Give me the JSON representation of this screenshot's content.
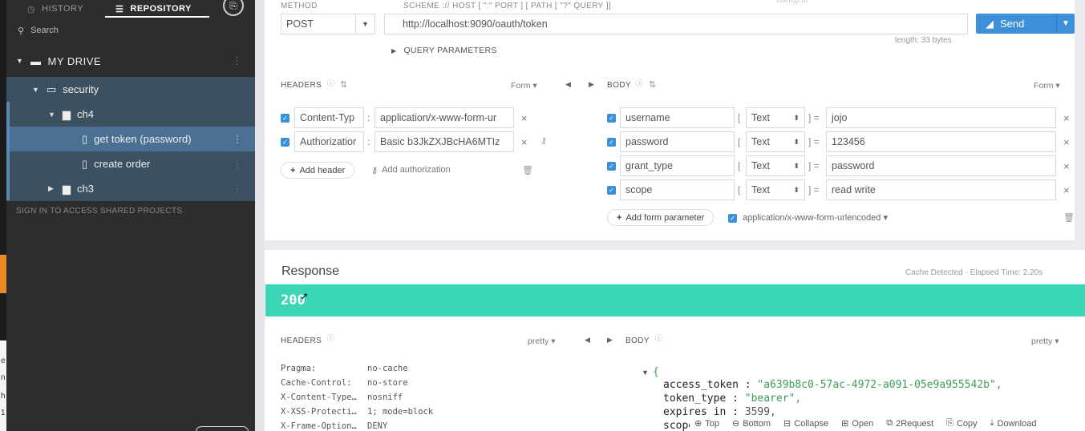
{
  "sidebar": {
    "tabs": {
      "history": "HISTORY",
      "repository": "REPOSITORY"
    },
    "search_placeholder": "Search",
    "drive_label": "MY DRIVE",
    "tree": {
      "security": "security",
      "ch4": "ch4",
      "get_token": "get token (password)",
      "create_order": "create order",
      "ch3": "ch3"
    },
    "signin_text": "SIGN IN TO ACCESS SHARED PROJECTS"
  },
  "request": {
    "method_label": "METHOD",
    "method": "POST",
    "scheme_label": "SCHEME :// HOST [ \":\" PORT ] [ PATH [ \"?\" QUERY ]]",
    "url": "http://localhost:9090/oauth/token",
    "length": "length: 33 bytes",
    "send_label": "Send",
    "query_params": "QUERY PARAMETERS",
    "watermark": "zhengchi"
  },
  "headers_section": {
    "title": "HEADERS",
    "form_label": "Form",
    "rows": [
      {
        "name": "Content-Typ",
        "value": "application/x-www-form-ur"
      },
      {
        "name": "Authorizatior",
        "value": "Basic b3JkZXJBcHA6MTIz"
      }
    ],
    "add_header": "Add header",
    "add_authorization": "Add authorization"
  },
  "body_section": {
    "title": "BODY",
    "form_label": "Form",
    "rows": [
      {
        "key": "username",
        "type": "Text",
        "value": "jojo"
      },
      {
        "key": "password",
        "type": "Text",
        "value": "123456"
      },
      {
        "key": "grant_type",
        "type": "Text",
        "value": "password"
      },
      {
        "key": "scope",
        "type": "Text",
        "value": "read write"
      }
    ],
    "add_param": "Add form parameter",
    "encoding": "application/x-www-form-urlencoded"
  },
  "response": {
    "title": "Response",
    "meta": "Cache Detected - Elapsed Time: 2.20s",
    "status": "200",
    "headers_title": "HEADERS",
    "headers_format": "pretty",
    "body_title": "BODY",
    "body_format": "pretty",
    "headers": [
      {
        "name": "Pragma:",
        "value": "no-cache"
      },
      {
        "name": "Cache-Control:",
        "value": "no-store"
      },
      {
        "name": "X-Content-Type…",
        "value": "nosniff"
      },
      {
        "name": "X-XSS-Protecti…",
        "value": "1; mode=block"
      },
      {
        "name": "X-Frame-Option…",
        "value": "DENY"
      }
    ],
    "json": {
      "access_token_key": "access_token :",
      "access_token_val": "\"a639b8c0-57ac-4972-a091-05e9a955542b\",",
      "token_type_key": "token_type :",
      "token_type_val": "\"bearer\",",
      "expires_key": "expires_in :",
      "expires_val": "3599,",
      "scope_key": "scope"
    },
    "toolbar": [
      "Top",
      "Bottom",
      "Collapse",
      "Open",
      "2Request",
      "Copy",
      "Download"
    ]
  },
  "strip_letters": [
    "e",
    "n",
    "h",
    "1"
  ]
}
